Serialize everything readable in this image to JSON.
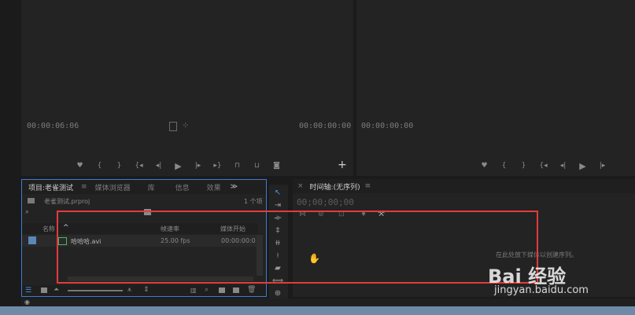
{
  "source_monitor": {
    "timecode_left": "00:00:06:06",
    "timecode_right": "00:00:00:00",
    "controls": [
      "marker-icon",
      "in-bracket-icon",
      "out-bracket-icon",
      "go-to-in-icon",
      "step-back-icon",
      "play-icon",
      "step-forward-icon",
      "go-to-out-icon",
      "insert-icon",
      "overwrite-icon",
      "camera-icon",
      "add-icon"
    ]
  },
  "program_monitor": {
    "timecode_left": "00:00:00:00",
    "controls": [
      "marker-icon",
      "in-bracket-icon",
      "out-bracket-icon",
      "go-to-in-icon",
      "step-back-icon",
      "play-icon",
      "step-forward-icon"
    ]
  },
  "project_panel": {
    "tabs": [
      "项目:老雀测试",
      "媒体浏览器",
      "库",
      "信息",
      "效果"
    ],
    "more_icon": "≫",
    "menu_icon": "≡",
    "project_file": "老雀测试.prproj",
    "item_count": "1 个项",
    "columns": {
      "name": "名称",
      "frame_rate": "帧速率",
      "media_start": "媒体开始"
    },
    "rows": [
      {
        "name": "哈哈哈.avi",
        "frame_rate": "25.00 fps",
        "media_start": "00:00:00:0"
      }
    ]
  },
  "tools": [
    "selection-tool-icon",
    "track-select-tool-icon",
    "ripple-edit-tool-icon",
    "rolling-edit-tool-icon",
    "rate-stretch-tool-icon",
    "razor-tool-icon",
    "slip-tool-icon",
    "slide-tool-icon",
    "pen-tool-icon",
    "hand-tool-icon"
  ],
  "timeline_panel": {
    "close": "×",
    "title": "时间轴:(无序列)",
    "menu_icon": "≡",
    "timecode": "00;00;00;00",
    "hint": "在此处放下媒体以创建序列。"
  },
  "watermark": {
    "brand": "Bai 经验",
    "url": "jingyan.baidu.com"
  },
  "colors": {
    "highlight_box": "#e33b3b",
    "active_panel_border": "#3d7bd6"
  }
}
